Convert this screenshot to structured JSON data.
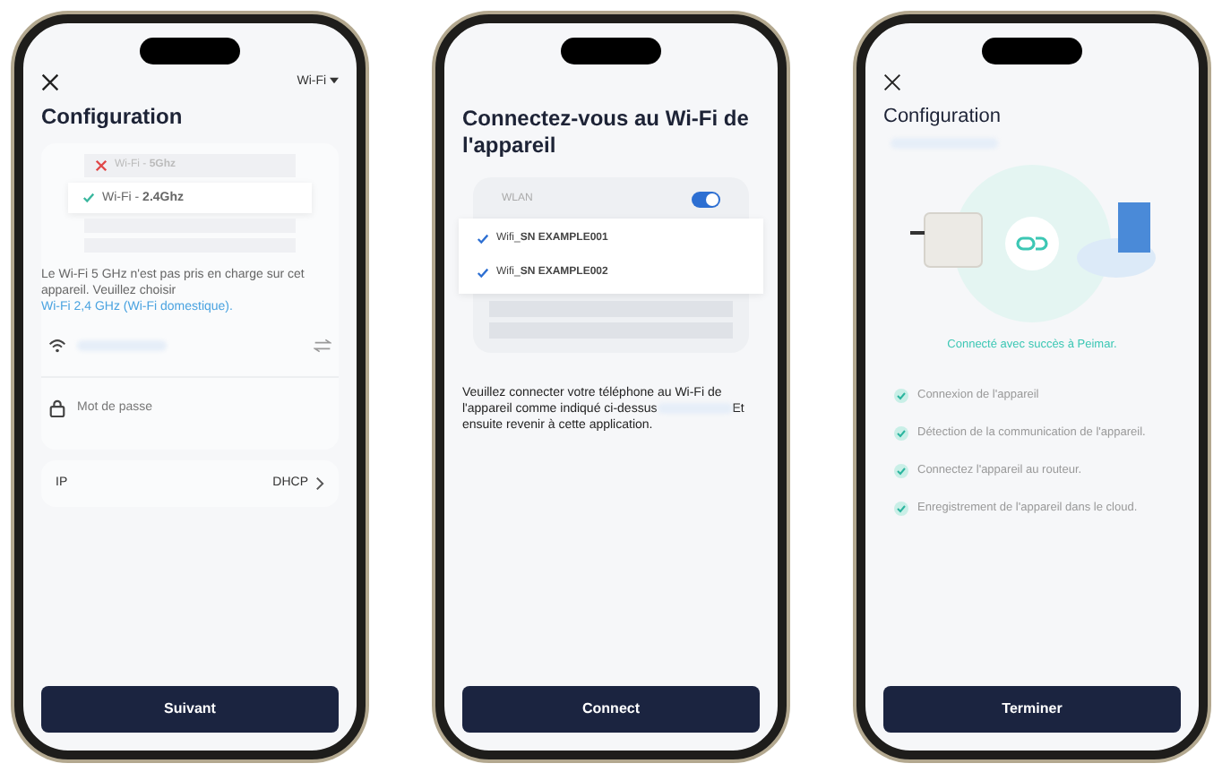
{
  "setup_screen": {
    "mode_dropdown": "Wi-Fi",
    "title": "Configuration",
    "networks": [
      {
        "label": "Wi-Fi - **5Ghz**",
        "supported": false
      },
      {
        "label": "Wi-Fi - **2.4Ghz**",
        "supported": true
      }
    ],
    "notice": "Le Wi-Fi 5 GHz n'est pas pris en charge sur cet appareil. Veuillez choisir",
    "notice_link": "Wi-Fi 2,4 GHz (Wi-Fi domestique).",
    "password_placeholder": "Mot de passe",
    "ip_label": "IP",
    "ip_value": "DHCP",
    "button": "Suivant"
  },
  "connect_screen": {
    "title": "Connectez-vous au Wi-Fi de l'appareil",
    "wlan_label": "WLAN",
    "wlan_on": true,
    "networks": [
      {
        "label": "Wifi_**SN EXAMPLE001**",
        "checked": true
      },
      {
        "label": "Wifi_**SN EXAMPLE002**",
        "checked": true
      }
    ],
    "instruction_start": "Veuillez connecter votre téléphone au Wi-Fi de l'appareil comme indiqué ci-dessus",
    "instruction_end": "Et ensuite revenir à cette application.",
    "button": "Connect"
  },
  "done_screen": {
    "title": "Configuration",
    "status": "Connecté avec succès à Peimar.",
    "steps": [
      {
        "label": "Connexion de l'appareil",
        "done": true
      },
      {
        "label": "Détection de la communication de l'appareil.",
        "done": true
      },
      {
        "label": "Connectez l'appareil au routeur.",
        "done": true
      },
      {
        "label": "Enregistrement de l'appareil dans le cloud.",
        "done": true
      }
    ],
    "button": "Terminer"
  }
}
